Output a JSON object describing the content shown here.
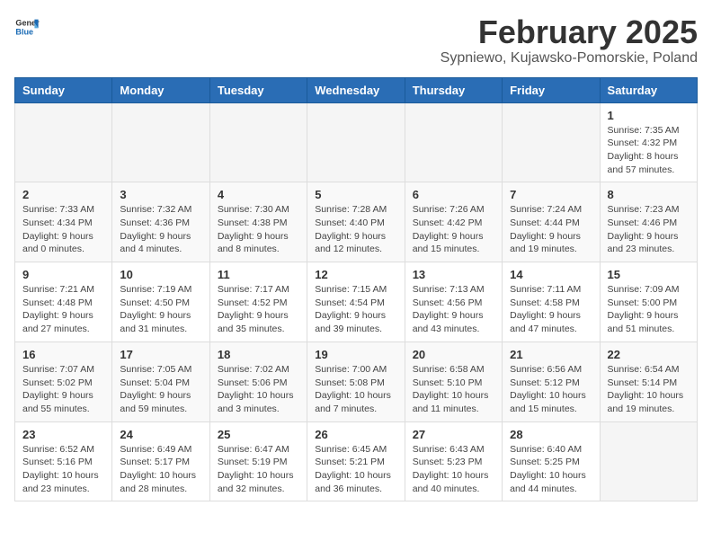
{
  "header": {
    "logo_line1": "General",
    "logo_line2": "Blue",
    "title": "February 2025",
    "subtitle": "Sypniewo, Kujawsko-Pomorskie, Poland"
  },
  "weekdays": [
    "Sunday",
    "Monday",
    "Tuesday",
    "Wednesday",
    "Thursday",
    "Friday",
    "Saturday"
  ],
  "weeks": [
    [
      {
        "day": "",
        "info": ""
      },
      {
        "day": "",
        "info": ""
      },
      {
        "day": "",
        "info": ""
      },
      {
        "day": "",
        "info": ""
      },
      {
        "day": "",
        "info": ""
      },
      {
        "day": "",
        "info": ""
      },
      {
        "day": "1",
        "info": "Sunrise: 7:35 AM\nSunset: 4:32 PM\nDaylight: 8 hours and 57 minutes."
      }
    ],
    [
      {
        "day": "2",
        "info": "Sunrise: 7:33 AM\nSunset: 4:34 PM\nDaylight: 9 hours and 0 minutes."
      },
      {
        "day": "3",
        "info": "Sunrise: 7:32 AM\nSunset: 4:36 PM\nDaylight: 9 hours and 4 minutes."
      },
      {
        "day": "4",
        "info": "Sunrise: 7:30 AM\nSunset: 4:38 PM\nDaylight: 9 hours and 8 minutes."
      },
      {
        "day": "5",
        "info": "Sunrise: 7:28 AM\nSunset: 4:40 PM\nDaylight: 9 hours and 12 minutes."
      },
      {
        "day": "6",
        "info": "Sunrise: 7:26 AM\nSunset: 4:42 PM\nDaylight: 9 hours and 15 minutes."
      },
      {
        "day": "7",
        "info": "Sunrise: 7:24 AM\nSunset: 4:44 PM\nDaylight: 9 hours and 19 minutes."
      },
      {
        "day": "8",
        "info": "Sunrise: 7:23 AM\nSunset: 4:46 PM\nDaylight: 9 hours and 23 minutes."
      }
    ],
    [
      {
        "day": "9",
        "info": "Sunrise: 7:21 AM\nSunset: 4:48 PM\nDaylight: 9 hours and 27 minutes."
      },
      {
        "day": "10",
        "info": "Sunrise: 7:19 AM\nSunset: 4:50 PM\nDaylight: 9 hours and 31 minutes."
      },
      {
        "day": "11",
        "info": "Sunrise: 7:17 AM\nSunset: 4:52 PM\nDaylight: 9 hours and 35 minutes."
      },
      {
        "day": "12",
        "info": "Sunrise: 7:15 AM\nSunset: 4:54 PM\nDaylight: 9 hours and 39 minutes."
      },
      {
        "day": "13",
        "info": "Sunrise: 7:13 AM\nSunset: 4:56 PM\nDaylight: 9 hours and 43 minutes."
      },
      {
        "day": "14",
        "info": "Sunrise: 7:11 AM\nSunset: 4:58 PM\nDaylight: 9 hours and 47 minutes."
      },
      {
        "day": "15",
        "info": "Sunrise: 7:09 AM\nSunset: 5:00 PM\nDaylight: 9 hours and 51 minutes."
      }
    ],
    [
      {
        "day": "16",
        "info": "Sunrise: 7:07 AM\nSunset: 5:02 PM\nDaylight: 9 hours and 55 minutes."
      },
      {
        "day": "17",
        "info": "Sunrise: 7:05 AM\nSunset: 5:04 PM\nDaylight: 9 hours and 59 minutes."
      },
      {
        "day": "18",
        "info": "Sunrise: 7:02 AM\nSunset: 5:06 PM\nDaylight: 10 hours and 3 minutes."
      },
      {
        "day": "19",
        "info": "Sunrise: 7:00 AM\nSunset: 5:08 PM\nDaylight: 10 hours and 7 minutes."
      },
      {
        "day": "20",
        "info": "Sunrise: 6:58 AM\nSunset: 5:10 PM\nDaylight: 10 hours and 11 minutes."
      },
      {
        "day": "21",
        "info": "Sunrise: 6:56 AM\nSunset: 5:12 PM\nDaylight: 10 hours and 15 minutes."
      },
      {
        "day": "22",
        "info": "Sunrise: 6:54 AM\nSunset: 5:14 PM\nDaylight: 10 hours and 19 minutes."
      }
    ],
    [
      {
        "day": "23",
        "info": "Sunrise: 6:52 AM\nSunset: 5:16 PM\nDaylight: 10 hours and 23 minutes."
      },
      {
        "day": "24",
        "info": "Sunrise: 6:49 AM\nSunset: 5:17 PM\nDaylight: 10 hours and 28 minutes."
      },
      {
        "day": "25",
        "info": "Sunrise: 6:47 AM\nSunset: 5:19 PM\nDaylight: 10 hours and 32 minutes."
      },
      {
        "day": "26",
        "info": "Sunrise: 6:45 AM\nSunset: 5:21 PM\nDaylight: 10 hours and 36 minutes."
      },
      {
        "day": "27",
        "info": "Sunrise: 6:43 AM\nSunset: 5:23 PM\nDaylight: 10 hours and 40 minutes."
      },
      {
        "day": "28",
        "info": "Sunrise: 6:40 AM\nSunset: 5:25 PM\nDaylight: 10 hours and 44 minutes."
      },
      {
        "day": "",
        "info": ""
      }
    ]
  ]
}
